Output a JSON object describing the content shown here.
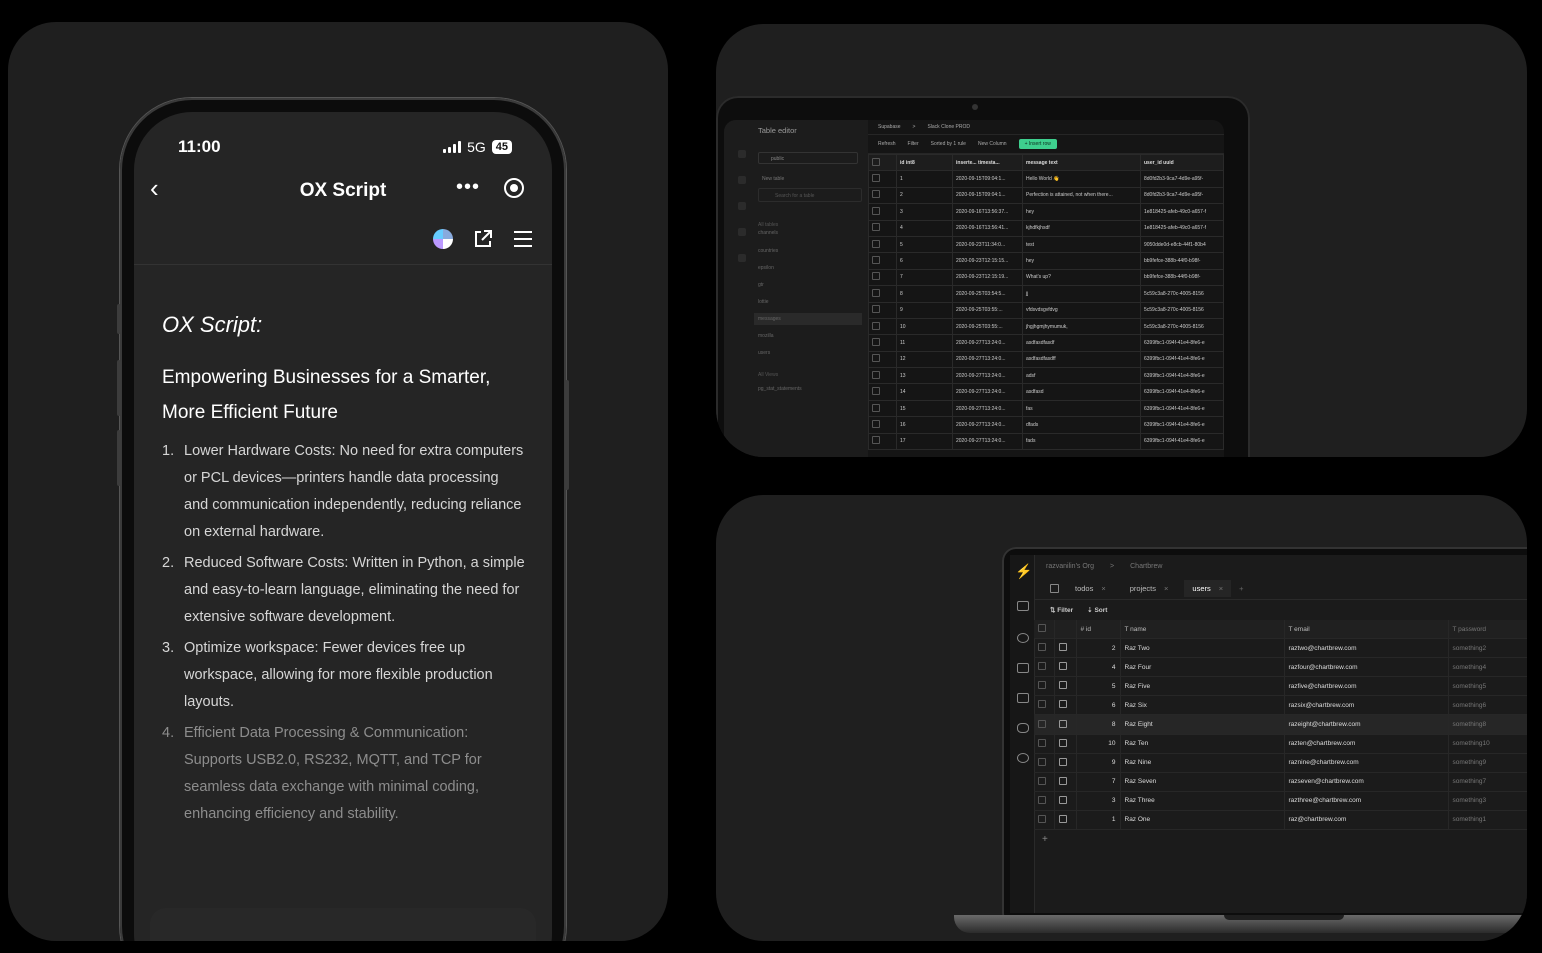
{
  "phone": {
    "status": {
      "time": "11:00",
      "network": "5G",
      "battery": "45"
    },
    "nav": {
      "title": "OX Script",
      "back_icon": "‹",
      "more_icon": "•••"
    },
    "heading": "OX Script:",
    "subheading": "Empowering Businesses for a Smarter, More Efficient Future",
    "items": [
      {
        "num": "1.",
        "text": "Lower Hardware Costs: No need for extra computers or PCL devices—printers handle data processing and communication independently, reducing reliance on external hardware."
      },
      {
        "num": "2.",
        "text": "Reduced Software Costs: Written in Python, a simple and easy-to-learn language, eliminating the need for extensive software development."
      },
      {
        "num": "3.",
        "text": "Optimize workspace: Fewer devices free up workspace, allowing for more flexible production layouts."
      },
      {
        "num": "4.",
        "text": "Efficient Data Processing & Communication: Supports USB2.0, RS232, MQTT, and TCP for seamless data exchange with minimal coding, enhancing efficiency and stability."
      }
    ]
  },
  "table_editor": {
    "title": "Table editor",
    "schema": "public",
    "new_table": "New table",
    "search_placeholder": "Search for a table",
    "section_tables": "All tables",
    "tables": [
      "channels",
      "countries",
      "epsilon",
      "gtr",
      "lottie",
      "messages",
      "mozilla",
      "users"
    ],
    "section_views": "All Views",
    "views": [
      "pg_stat_statements"
    ],
    "breadcrumb": [
      "Supabase",
      ">",
      "Slack Clone PROD"
    ],
    "toolbar": {
      "refresh": "Refresh",
      "filter": "Filter",
      "sorted": "Sorted by 1 rule",
      "new_column": "New Column",
      "insert": "+ Insert row"
    },
    "columns": [
      "id  int8",
      "inserte...  timesta...",
      "message  text",
      "user_id  uuid"
    ],
    "rows": [
      [
        "1",
        "2020-09-15T09:04:1...",
        "Hello World 👋",
        "8d0fd2b3-9ca7-4d9e-a95f-"
      ],
      [
        "2",
        "2020-09-15T09:04:1...",
        "Perfection is attained, not when there...",
        "8d0fd2b3-9ca7-4d9e-a95f-"
      ],
      [
        "3",
        "2020-09-16T13:56:37...",
        "hey",
        "1e818425-afeb-49c0-a657-f"
      ],
      [
        "4",
        "2020-09-16T13:56:41...",
        "kjhdfkjhsdf",
        "1e818425-afeb-49c0-a657-f"
      ],
      [
        "5",
        "2020-09-23T11:34:0...",
        "test",
        "9050dde0d-e8cb-44f1-80b4"
      ],
      [
        "6",
        "2020-09-23T12:15:15...",
        "hey",
        "bb9fefce-388b-44f0-b98f-"
      ],
      [
        "7",
        "2020-09-23T12:15:19...",
        "What's up?",
        "bb9fefce-388b-44f0-b98f-"
      ],
      [
        "8",
        "2020-09-25T03:54:5...",
        "jj",
        "5c59c3a8-270c-4005-8156"
      ],
      [
        "9",
        "2020-09-25T03:55:...",
        "vfdsvdsgvfdvg",
        "5c59c3a8-270c-4005-8156"
      ],
      [
        "10",
        "2020-09-25T03:55:...",
        "jhgjhgmjhymumuk,",
        "5c59c3a8-270c-4005-8156"
      ],
      [
        "11",
        "2020-09-27T13:24:0...",
        "asdfasdfasdf",
        "6399fbc1-094f-41e4-8fe6-e"
      ],
      [
        "12",
        "2020-09-27T13:24:0...",
        "asdfasdfasdff",
        "6399fbc1-094f-41e4-8fe6-e"
      ],
      [
        "13",
        "2020-09-27T13:24:0...",
        "adsf",
        "6399fbc1-094f-41e4-8fe6-e"
      ],
      [
        "14",
        "2020-09-27T13:24:0...",
        "asdfasd",
        "6399fbc1-094f-41e4-8fe6-e"
      ],
      [
        "15",
        "2020-09-27T13:24:0...",
        "fas",
        "6399fbc1-094f-41e4-8fe6-e"
      ],
      [
        "16",
        "2020-09-27T13:24:0...",
        "dfads",
        "6399fbc1-094f-41e4-8fe6-e"
      ],
      [
        "17",
        "2020-09-27T13:24:0...",
        "fads",
        "6399fbc1-094f-41e4-8fe6-e"
      ]
    ]
  },
  "chartbrew": {
    "breadcrumb": [
      "razvanilin's Org",
      ">",
      "Chartbrew"
    ],
    "tabs": [
      {
        "label": "todos",
        "active": false
      },
      {
        "label": "projects",
        "active": false
      },
      {
        "label": "users",
        "active": true
      }
    ],
    "add_tab": "+",
    "toolbar": {
      "filter": "Filter",
      "sort": "Sort"
    },
    "columns": {
      "id": "# id",
      "name": "T  name",
      "email": "T  email",
      "password": "T  password"
    },
    "rows": [
      {
        "id": "2",
        "name": "Raz Two",
        "email": "raztwo@chartbrew.com",
        "password": "something2"
      },
      {
        "id": "4",
        "name": "Raz Four",
        "email": "razfour@chartbrew.com",
        "password": "something4"
      },
      {
        "id": "5",
        "name": "Raz Five",
        "email": "razfive@chartbrew.com",
        "password": "something5"
      },
      {
        "id": "6",
        "name": "Raz Six",
        "email": "razsix@chartbrew.com",
        "password": "something6"
      },
      {
        "id": "8",
        "name": "Raz Eight",
        "email": "razeight@chartbrew.com",
        "password": "something8"
      },
      {
        "id": "10",
        "name": "Raz Ten",
        "email": "razten@chartbrew.com",
        "password": "something10"
      },
      {
        "id": "9",
        "name": "Raz Nine",
        "email": "raznine@chartbrew.com",
        "password": "something9"
      },
      {
        "id": "7",
        "name": "Raz Seven",
        "email": "razseven@chartbrew.com",
        "password": "something7"
      },
      {
        "id": "3",
        "name": "Raz Three",
        "email": "razthree@chartbrew.com",
        "password": "something3"
      },
      {
        "id": "1",
        "name": "Raz One",
        "email": "raz@chartbrew.com",
        "password": "something1"
      }
    ],
    "add_row": "+"
  }
}
